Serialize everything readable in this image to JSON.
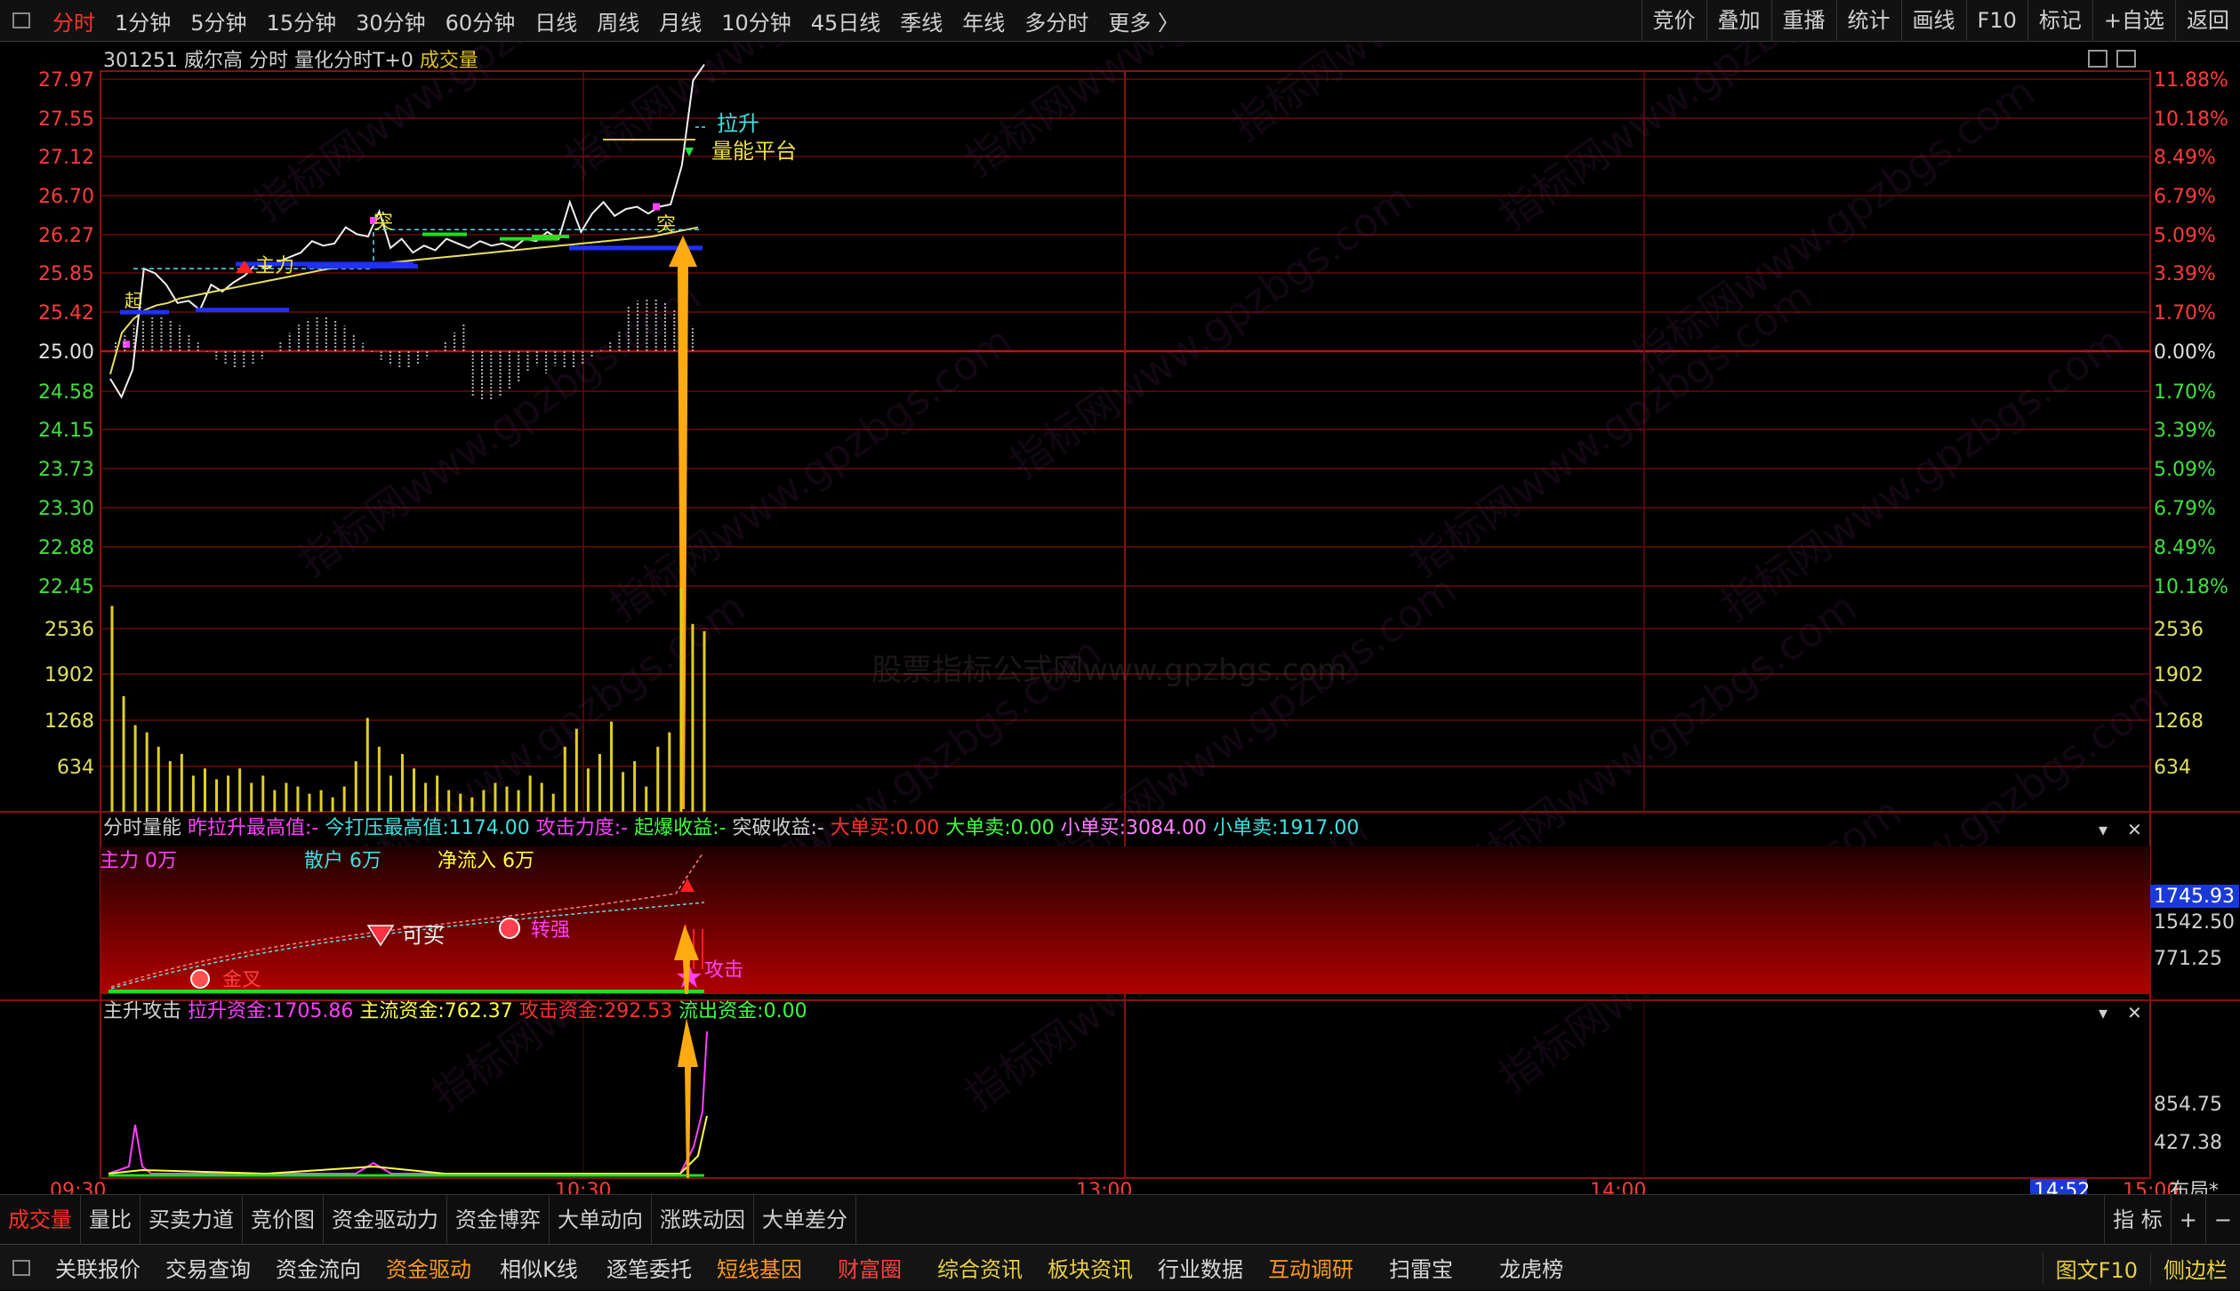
{
  "topbar": {
    "periods": [
      "分时",
      "1分钟",
      "5分钟",
      "15分钟",
      "30分钟",
      "60分钟",
      "日线",
      "周线",
      "月线",
      "10分钟",
      "45日线",
      "季线",
      "年线",
      "多分时",
      "更多 〉"
    ],
    "active_index": 0,
    "tools": [
      "竞价",
      "叠加",
      "重播",
      "统计",
      "画线",
      "F10",
      "标记",
      "+自选",
      "返回"
    ]
  },
  "header": {
    "code": "301251",
    "name": "威尔高",
    "mode": "分时",
    "indicator": "量化分时T+0",
    "volume_label": "成交量"
  },
  "price_axis": {
    "up_labels": [
      "27.97",
      "27.55",
      "27.12",
      "26.70",
      "26.27",
      "25.85",
      "25.42"
    ],
    "base": "25.00",
    "down_labels": [
      "24.58",
      "24.15",
      "23.73",
      "23.30",
      "22.88",
      "22.45"
    ],
    "pct_up": [
      "11.88%",
      "10.18%",
      "8.49%",
      "6.79%",
      "5.09%",
      "3.39%",
      "1.70%"
    ],
    "pct_base": "0.00%",
    "pct_down": [
      "1.70%",
      "3.39%",
      "5.09%",
      "6.79%",
      "8.49%",
      "10.18%"
    ],
    "vol_labels": [
      "2536",
      "1902",
      "1268",
      "634"
    ]
  },
  "price_annotations": {
    "breakout": "拉升",
    "platform": "量能平台",
    "tu1": "突",
    "tu2": "突",
    "zhuli": "主力",
    "start": "起"
  },
  "watermark": "股票指标公式网www.gpzbgs.com",
  "watermark_repeat": "指标网www.gpzbgs.com",
  "panel2": {
    "title": "分时量能",
    "metrics": [
      {
        "label": "昨拉升最高值:",
        "value": "-",
        "color": "#ff40ff"
      },
      {
        "label": "今打压最高值:",
        "value": "1174.00",
        "color": "#40e0e0"
      },
      {
        "label": "攻击力度:",
        "value": "-",
        "color": "#ff40ff"
      },
      {
        "label": "起爆收益:",
        "value": "-",
        "color": "#40ff40"
      },
      {
        "label": "突破收益:",
        "value": "-",
        "color": "#d0d0d0"
      },
      {
        "label": "大单买:",
        "value": "0.00",
        "color": "#ff3030"
      },
      {
        "label": "大单卖:",
        "value": "0.00",
        "color": "#40ff40"
      },
      {
        "label": "小单买:",
        "value": "3084.00",
        "color": "#ff80ff"
      },
      {
        "label": "小单卖:",
        "value": "1917.00",
        "color": "#40e0e0"
      }
    ],
    "line2": [
      {
        "label": "主力 0万",
        "color": "#ff40ff"
      },
      {
        "label": "散户 6万",
        "color": "#40e0e0"
      },
      {
        "label": "净流入 6万",
        "color": "#ffff40"
      }
    ],
    "axis": [
      "1745.93",
      "1542.50",
      "771.25"
    ],
    "marks": {
      "jincha": "金叉",
      "keimai": "可买",
      "zhuanqiang": "转强",
      "gongji": "攻击"
    }
  },
  "panel3": {
    "title": "主升攻击",
    "metrics": [
      {
        "label": "拉升资金:",
        "value": "1705.86",
        "color": "#ff40ff"
      },
      {
        "label": "主流资金:",
        "value": "762.37",
        "color": "#ffff40"
      },
      {
        "label": "攻击资金:",
        "value": "292.53",
        "color": "#ff3030"
      },
      {
        "label": "流出资金:",
        "value": "0.00",
        "color": "#40ff40"
      }
    ],
    "axis": [
      "854.75",
      "427.38"
    ]
  },
  "time_axis": {
    "labels": [
      "09:30",
      "10:30",
      "13:00",
      "14:00",
      "15:00"
    ],
    "current": "14:52",
    "layout_btn": "布局*"
  },
  "tabs": [
    "成交量",
    "量比",
    "买卖力道",
    "竞价图",
    "资金驱动力",
    "资金博弈",
    "大单动向",
    "涨跌动因",
    "大单差分"
  ],
  "tabs_active_index": 0,
  "tabs_right": [
    "指 标",
    "+",
    "−"
  ],
  "bottom_links": [
    {
      "label": "关联报价",
      "cls": ""
    },
    {
      "label": "交易查询",
      "cls": ""
    },
    {
      "label": "资金流向",
      "cls": ""
    },
    {
      "label": "资金驱动",
      "cls": "orange"
    },
    {
      "label": "相似K线",
      "cls": ""
    },
    {
      "label": "逐笔委托",
      "cls": ""
    },
    {
      "label": "短线基因",
      "cls": "orange"
    },
    {
      "label": "财富圈",
      "cls": "red"
    },
    {
      "label": "综合资讯",
      "cls": "yellow"
    },
    {
      "label": "板块资讯",
      "cls": "yellow"
    },
    {
      "label": "行业数据",
      "cls": ""
    },
    {
      "label": "互动调研",
      "cls": "orange"
    },
    {
      "label": "扫雷宝",
      "cls": ""
    },
    {
      "label": "龙虎榜",
      "cls": ""
    }
  ],
  "bottom_right": [
    "图文F10",
    "侧边栏"
  ],
  "series": {
    "price_pct": [
      -1.2,
      -2.0,
      -0.8,
      3.6,
      3.4,
      2.9,
      2.1,
      2.2,
      1.8,
      2.9,
      2.6,
      3.0,
      3.3,
      3.8,
      3.6,
      3.9,
      4.1,
      4.3,
      4.8,
      4.6,
      4.7,
      5.4,
      5.1,
      5.0,
      6.1,
      4.5,
      4.9,
      4.3,
      4.6,
      4.4,
      4.9,
      4.7,
      4.5,
      4.8,
      4.6,
      4.7,
      4.5,
      4.9,
      4.8,
      5.2,
      4.9,
      6.5,
      5.2,
      6.0,
      6.5,
      5.9,
      6.2,
      6.3,
      6.0,
      6.3,
      6.4,
      8.1,
      11.8,
      12.5
    ],
    "avg_pct": [
      -1.0,
      0.8,
      1.4,
      1.8,
      2.0,
      2.1,
      2.3,
      2.4,
      2.5,
      2.6,
      2.7,
      2.8,
      2.9,
      3.0,
      3.1,
      3.2,
      3.3,
      3.4,
      3.5,
      3.6,
      3.65,
      3.7,
      3.75,
      3.8,
      3.85,
      3.9,
      3.95,
      4.0,
      4.05,
      4.1,
      4.15,
      4.2,
      4.25,
      4.3,
      4.35,
      4.4,
      4.45,
      4.5,
      4.55,
      4.6,
      4.65,
      4.7,
      4.75,
      4.8,
      4.85,
      4.9,
      4.95,
      5.0,
      5.1,
      5.2,
      5.3,
      5.4
    ],
    "volume": [
      2850,
      1600,
      1200,
      1100,
      900,
      700,
      800,
      500,
      600,
      450,
      500,
      600,
      400,
      500,
      300,
      400,
      350,
      250,
      300,
      200,
      350,
      700,
      1300,
      900,
      500,
      800,
      600,
      400,
      500,
      300,
      250,
      200,
      300,
      400,
      350,
      300,
      500,
      400,
      250,
      900,
      1150,
      600,
      800,
      1250,
      550,
      700,
      350,
      900,
      1100,
      3100,
      2600,
      2500
    ]
  }
}
